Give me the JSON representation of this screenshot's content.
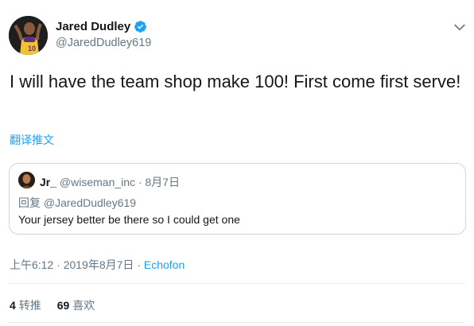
{
  "author": {
    "name": "Jared Dudley",
    "handle": "@JaredDudley619",
    "verified": true
  },
  "tweet": {
    "text": "I will have the team shop make 100! First come first serve!",
    "translate_label": "翻译推文"
  },
  "quoted": {
    "name": "Jr_",
    "handle": "@wiseman_inc",
    "separator": "·",
    "date": "8月7日",
    "reply_prefix": "回复",
    "reply_handle": "@JaredDudley619",
    "text": "Your jersey better be there so I could get one"
  },
  "meta": {
    "time": "上午6:12",
    "separator": "·",
    "date": "2019年8月7日",
    "source": "Echofon"
  },
  "stats": {
    "retweets_count": "4",
    "retweets_label": "转推",
    "likes_count": "69",
    "likes_label": "喜欢"
  },
  "colors": {
    "accent": "#1da1f2",
    "secondary_text": "#657786",
    "primary_text": "#14171a",
    "border": "#ccd6dd",
    "divider": "#e6ecf0"
  },
  "icons": {
    "verified": "verified-badge-icon",
    "menu": "chevron-down-icon"
  }
}
